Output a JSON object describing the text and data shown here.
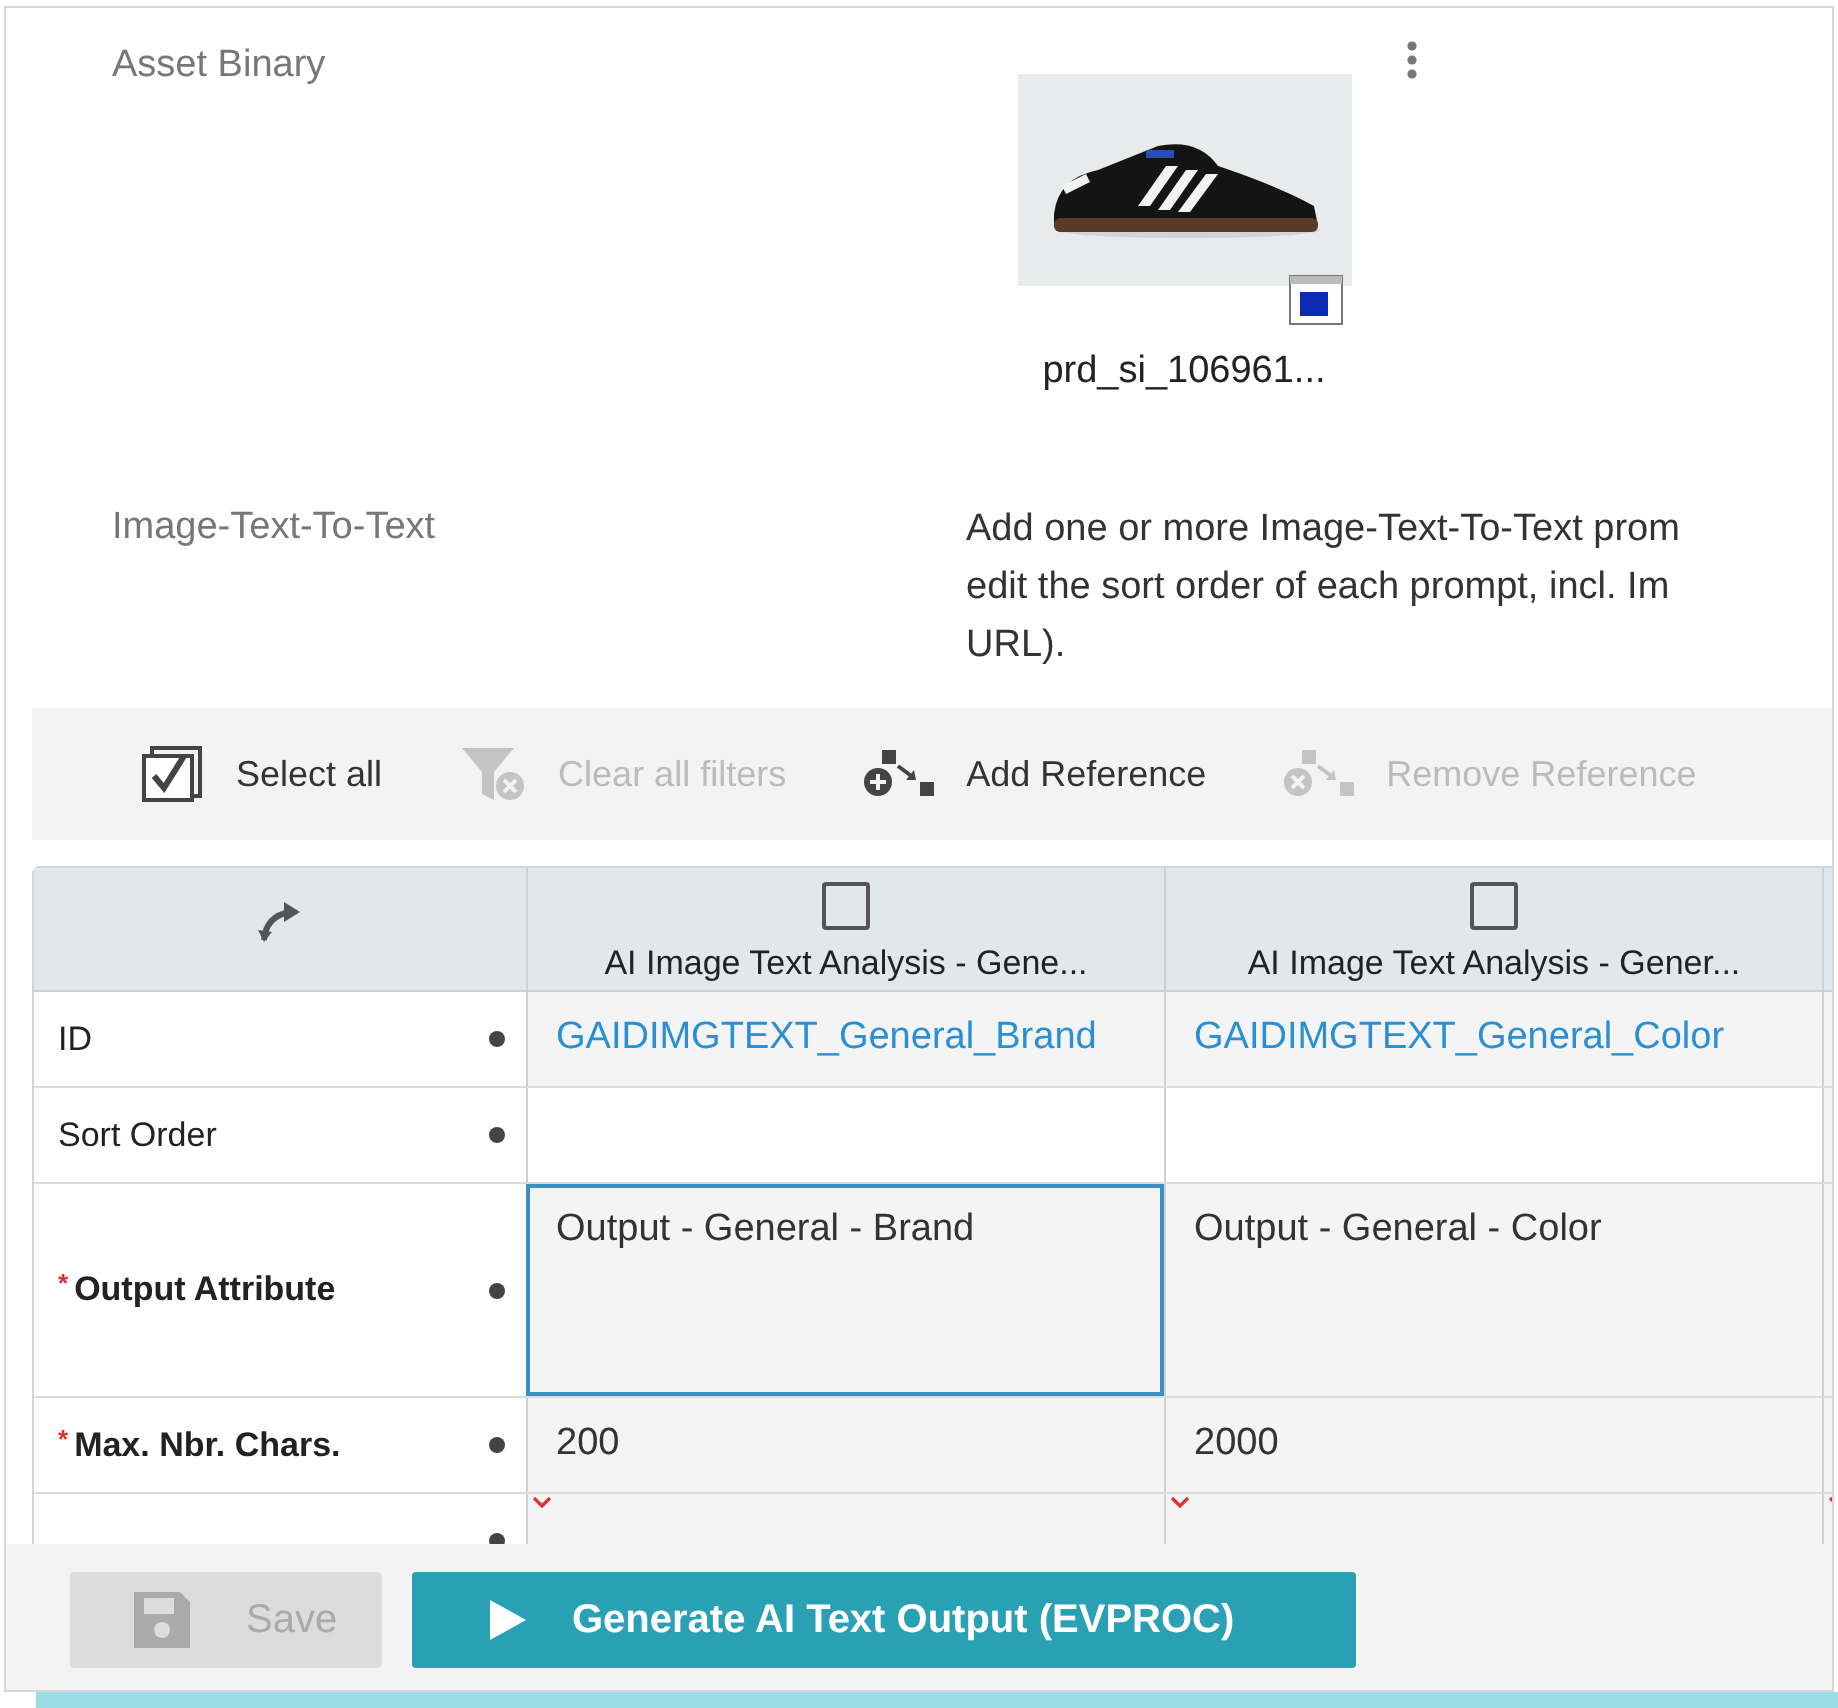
{
  "asset": {
    "label": "Asset Binary",
    "filename": "prd_si_106961..."
  },
  "prompts": {
    "label": "Image-Text-To-Text",
    "description_lines": [
      "Add one or more Image-Text-To-Text prom",
      "edit the sort order of each prompt, incl. Im",
      "URL)."
    ]
  },
  "toolbar": [
    {
      "label": "Select all",
      "disabled": false,
      "kind": "select"
    },
    {
      "label": "Clear all filters",
      "disabled": true,
      "kind": "filter"
    },
    {
      "label": "Add Reference",
      "disabled": false,
      "kind": "add"
    },
    {
      "label": "Remove Reference",
      "disabled": true,
      "kind": "remove"
    }
  ],
  "table": {
    "columns": [
      {
        "title": "AI Image Text Analysis - Gene...",
        "checked": false
      },
      {
        "title": "AI Image Text Analysis - Gener...",
        "checked": false
      }
    ],
    "rows": [
      {
        "label": "ID",
        "kind": "link",
        "cells": [
          {
            "value": "GAIDIMGTEXT_General_Brand",
            "focused": false
          },
          {
            "value": "GAIDIMGTEXT_General_Color",
            "focused": false
          }
        ]
      },
      {
        "label": "Sort Order",
        "kind": "plain",
        "cells": [
          {
            "focused": false
          },
          {
            "focused": false
          }
        ]
      },
      {
        "label": "Output Attribute",
        "required_mark": "*",
        "kind": "tall",
        "cells": [
          {
            "value": "Output - General - Brand",
            "focused": true
          },
          {
            "value": "Output - General - Color",
            "focused": false
          }
        ]
      },
      {
        "label": "Max. Nbr. Chars.",
        "required_mark": "*",
        "kind": "plain",
        "cells": [
          {
            "value": "200",
            "focused": false
          },
          {
            "value": "2000",
            "focused": false
          }
        ]
      },
      {
        "kind": "cut",
        "cells": [
          {
            "focused": false
          },
          {
            "focused": false
          }
        ]
      }
    ]
  },
  "footer": {
    "buttons": [
      {
        "label": "Save",
        "disabled": true,
        "kind": "save"
      },
      {
        "label": "Generate AI Text Output (EVPROC)",
        "disabled": false,
        "kind": "run"
      }
    ]
  }
}
